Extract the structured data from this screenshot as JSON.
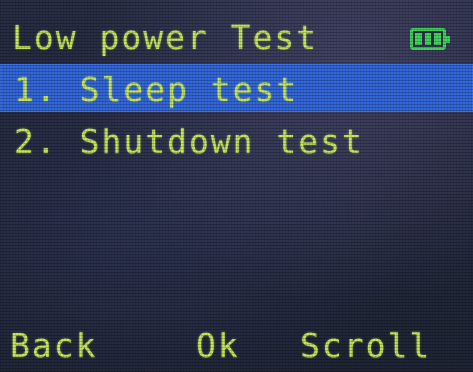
{
  "header": {
    "title": "Low power Test",
    "battery_icon": "battery-full-icon",
    "battery_color": "#3fd35a",
    "battery_level": 1.0
  },
  "menu": {
    "items": [
      {
        "label": "1. Sleep test",
        "selected": true
      },
      {
        "label": "2. Shutdown test",
        "selected": false
      }
    ],
    "highlight_color": "#2f63d6"
  },
  "softkeys": {
    "back": "Back",
    "ok": "Ok",
    "scroll": "Scroll"
  },
  "colors": {
    "text": "#c4e65a",
    "background": "#1f2438"
  }
}
